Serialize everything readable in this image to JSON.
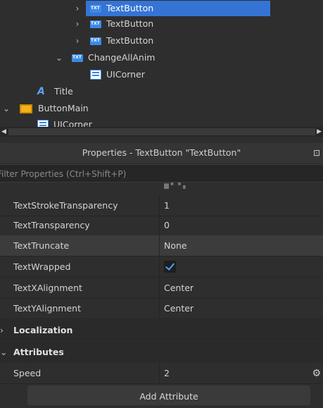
{
  "explorer": {
    "items": [
      {
        "label": "TextButton",
        "icon": "textbutton-icon",
        "selected": true
      },
      {
        "label": "TextButton",
        "icon": "textbutton-icon"
      },
      {
        "label": "TextButton",
        "icon": "textbutton-icon"
      },
      {
        "label": "ChangeAllAnim",
        "icon": "textbutton-icon"
      },
      {
        "label": "UICorner",
        "icon": "uicorner-icon"
      },
      {
        "label": "Title",
        "icon": "textlabel-icon"
      },
      {
        "label": "ButtonMain",
        "icon": "frame-icon"
      },
      {
        "label": "UICorner",
        "icon": "uicorner-icon"
      }
    ]
  },
  "properties": {
    "title": "Properties - TextButton \"TextButton\"",
    "filter_placeholder": "Filter Properties (Ctrl+Shift+P)",
    "rows": [
      {
        "name": "TextStrokeTransparency",
        "value": "1"
      },
      {
        "name": "TextTransparency",
        "value": "0"
      },
      {
        "name": "TextTruncate",
        "value": "None"
      },
      {
        "name": "TextWrapped",
        "value": "checked"
      },
      {
        "name": "TextXAlignment",
        "value": "Center"
      },
      {
        "name": "TextYAlignment",
        "value": "Center"
      }
    ],
    "sections": {
      "localization": "Localization",
      "attributes": "Attributes"
    },
    "attributes": [
      {
        "name": "Speed",
        "value": "2"
      }
    ],
    "add_attribute": "Add Attribute"
  },
  "colors": {
    "selection": "#3574d4",
    "accent_check": "#4aa3ff",
    "background": "#2e2e2e"
  }
}
